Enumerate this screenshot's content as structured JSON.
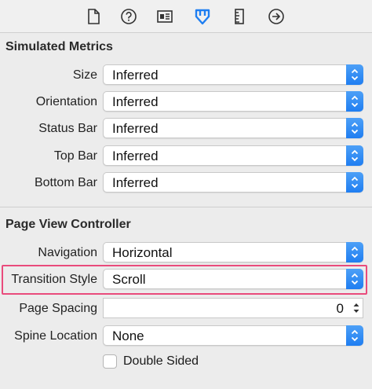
{
  "toolbar": {
    "icons": [
      "file-icon",
      "help-icon",
      "identity-icon",
      "attributes-icon",
      "size-ruler-icon",
      "connections-icon"
    ],
    "active_icon": "attributes-icon",
    "active_color": "#1e7ef1"
  },
  "simulated_metrics": {
    "title": "Simulated Metrics",
    "rows": [
      {
        "label": "Size",
        "value": "Inferred"
      },
      {
        "label": "Orientation",
        "value": "Inferred"
      },
      {
        "label": "Status Bar",
        "value": "Inferred"
      },
      {
        "label": "Top Bar",
        "value": "Inferred"
      },
      {
        "label": "Bottom Bar",
        "value": "Inferred"
      }
    ]
  },
  "page_view_controller": {
    "title": "Page View Controller",
    "navigation": {
      "label": "Navigation",
      "value": "Horizontal"
    },
    "transition_style": {
      "label": "Transition Style",
      "value": "Scroll"
    },
    "page_spacing": {
      "label": "Page Spacing",
      "value": "0"
    },
    "spine_location": {
      "label": "Spine Location",
      "value": "None"
    },
    "double_sided": {
      "label": "Double Sided",
      "checked": false
    }
  },
  "colors": {
    "accent": "#1e7ef1",
    "highlight": "#e94b7c"
  }
}
